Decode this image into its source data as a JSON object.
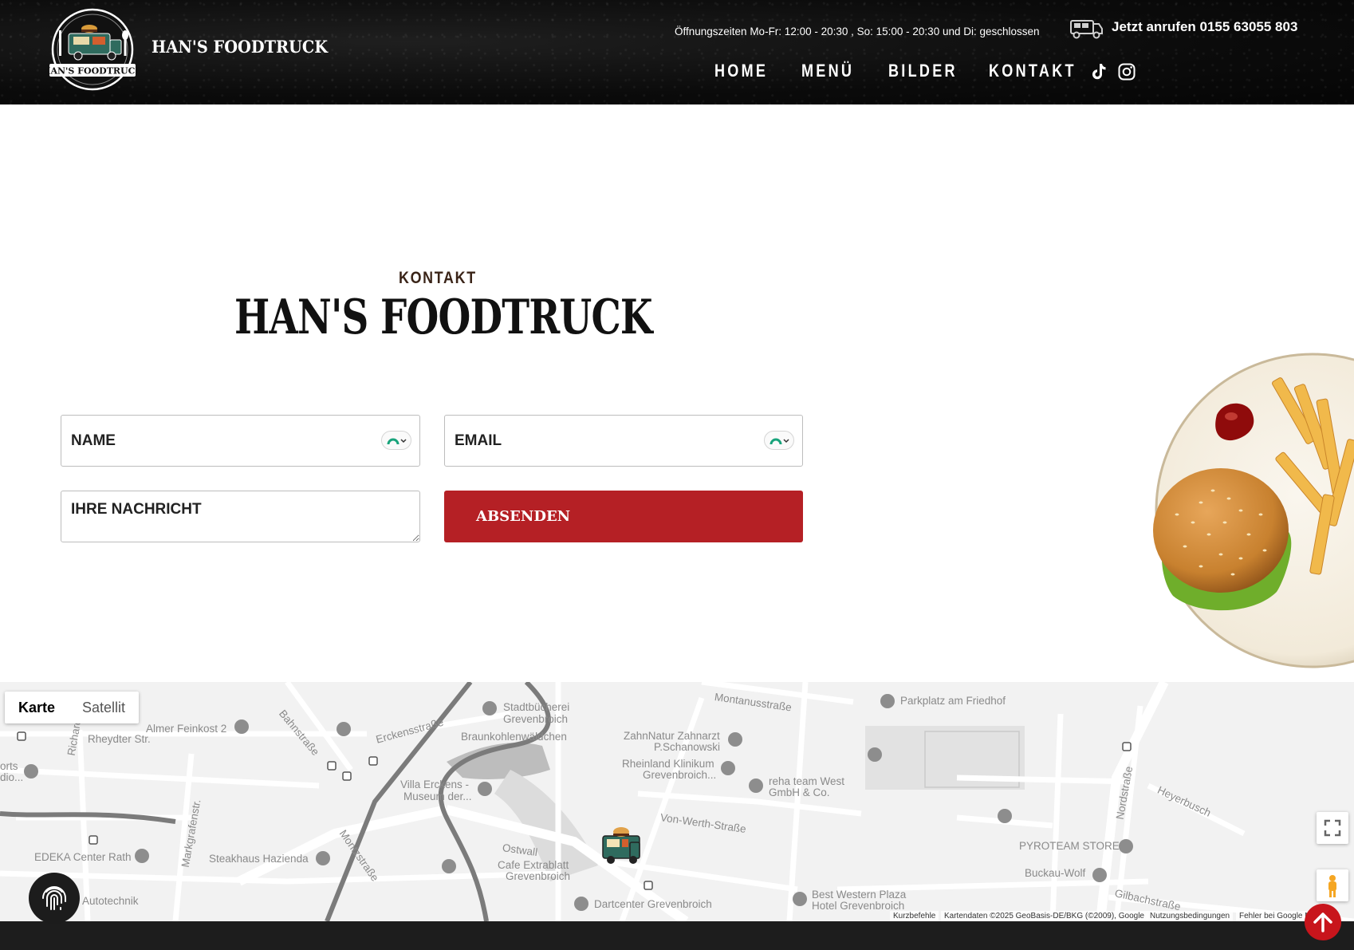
{
  "header": {
    "brand_name": "HAN'S FOODTRUCK",
    "logo_text": "HAN'S FOODTRUCK",
    "hours": "Öffnungszeiten Mo-Fr: 12:00 - 20:30 , So: 15:00 - 20:30 und Di: geschlossen",
    "call": "Jetzt anrufen 0155 63055 803",
    "nav": [
      "HOME",
      "MENÜ",
      "BILDER",
      "KONTAKT"
    ],
    "social": [
      "tiktok-icon",
      "instagram-icon"
    ]
  },
  "contact": {
    "eyebrow": "KONTAKT",
    "title": "HAN'S FOODTRUCK",
    "name_placeholder": "NAME",
    "email_placeholder": "EMAIL",
    "message_placeholder": "IHRE NACHRICHT",
    "submit_label": "ABSENDEN"
  },
  "map": {
    "type_buttons": [
      "Karte",
      "Satellit"
    ],
    "active_type": "Karte",
    "labels": [
      "Almer Feinkost 2",
      "Rheydter Str.",
      "Richard",
      "Bahnstraße",
      "Erckensstraße",
      "Stadtbücherei",
      "Grevenbroich",
      "Braunkohlenwäldchen",
      "Montanusstraße",
      "Parkplatz am Friedhof",
      "ZahnNatur Zahnarzt",
      "P.Schanowski",
      "Rheinland Klinikum",
      "Grevenbroich...",
      "reha team West",
      "GmbH & Co.",
      "Villa Erckens -",
      "Museum der...",
      "Von-Werth-Straße",
      "Heyerbusch",
      "Nordstraße",
      "PYROTEAM STORE",
      "Ostwall",
      "Cafe Extrablatt",
      "Grevenbroich",
      "EDEKA Center Rath",
      "Steakhaus Hazienda",
      "Montzstraße",
      "Markgrafenstr.",
      "Autotechnik",
      "Buckau-Wolf",
      "Gilbachstraße",
      "Best Western Plaza",
      "Hotel Grevenbroich",
      "Dartcenter Grevenbroich",
      "orts",
      "dio..."
    ],
    "attribution": {
      "shortcuts": "Kurzbefehle",
      "data": "Kartendaten ©2025 GeoBasis-DE/BKG (©2009), Google",
      "terms": "Nutzungsbedingungen",
      "report": "Fehler bei Google M  den"
    }
  },
  "colors": {
    "header_bg": "#0b0b0b",
    "submit_bg": "#b52025",
    "scroll_top_bg": "#c8151c",
    "title_color": "#111111",
    "eyebrow_color": "#3a2418"
  }
}
